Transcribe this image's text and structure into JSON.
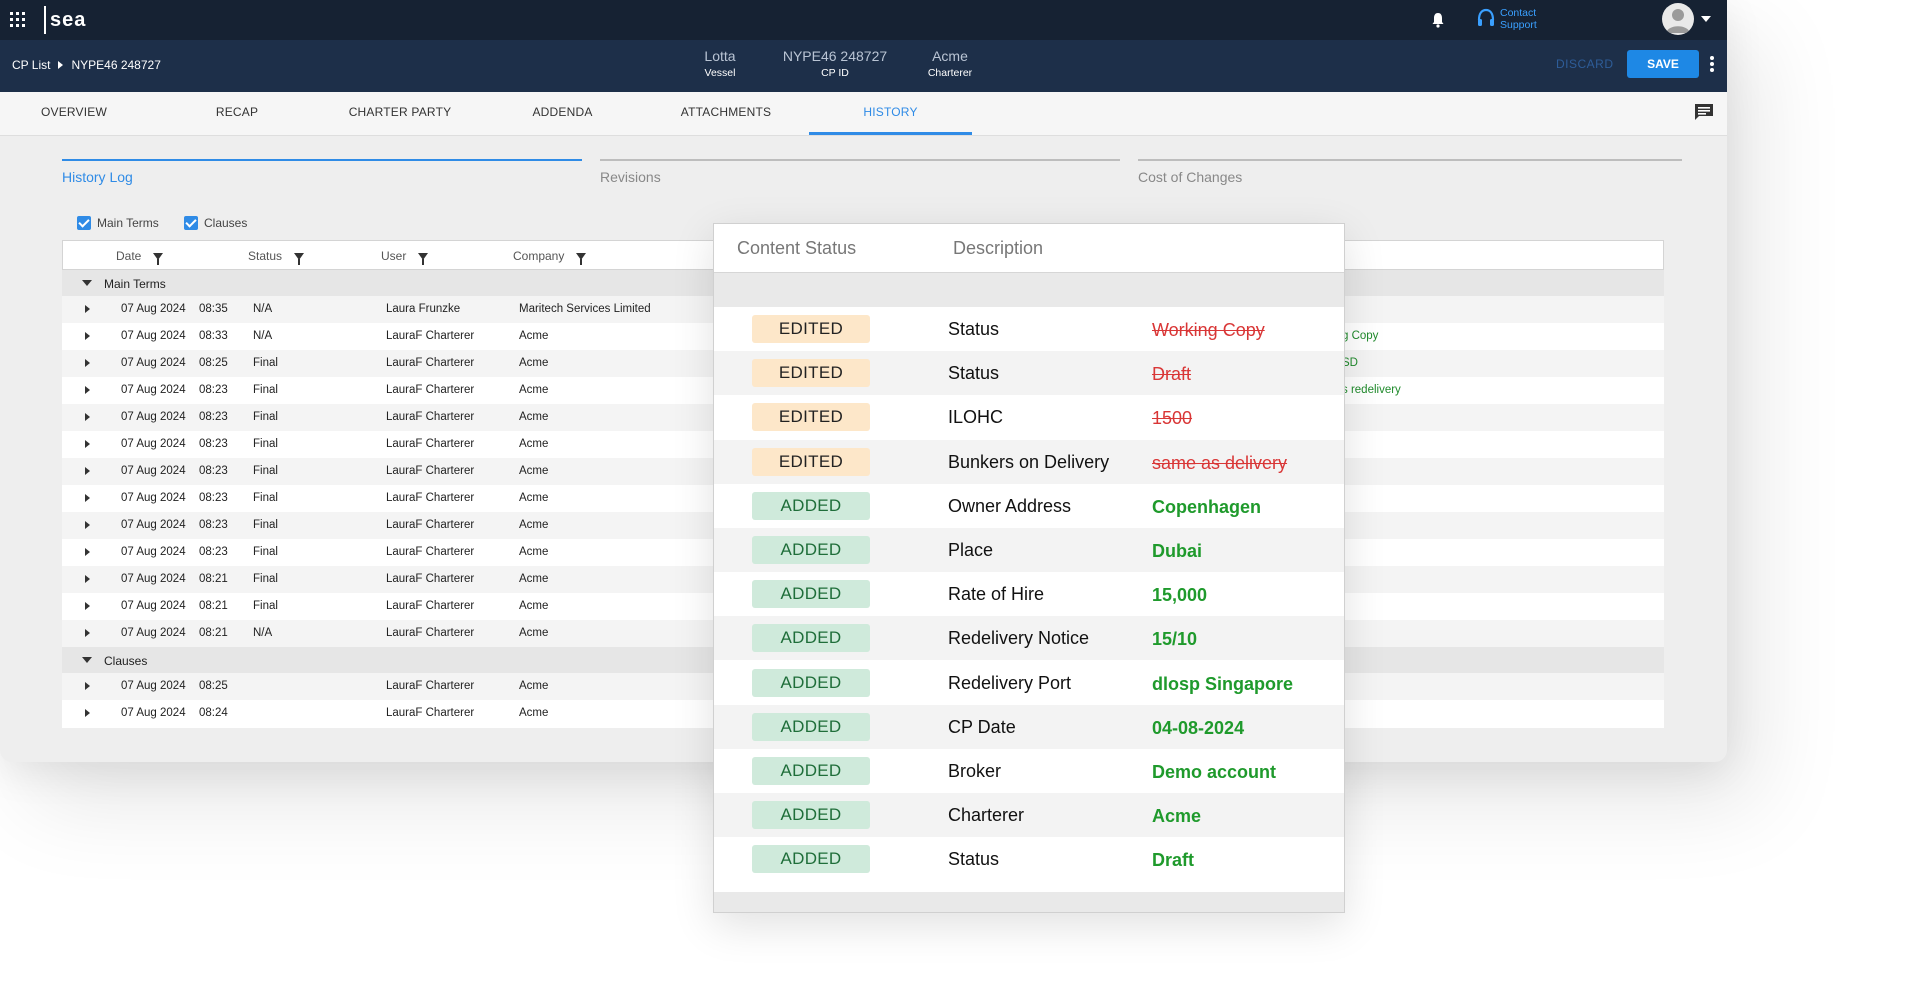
{
  "app": {
    "logo_text": "sea"
  },
  "topbar": {
    "support_line1": "Contact",
    "support_line2": "Support"
  },
  "subbar": {
    "breadcrumb": [
      "CP List",
      "NYPE46 248727"
    ],
    "meta": [
      {
        "value": "Lotta",
        "label": "Vessel"
      },
      {
        "value": "NYPE46 248727",
        "label": "CP ID"
      },
      {
        "value": "Acme",
        "label": "Charterer"
      }
    ],
    "discard_label": "DISCARD",
    "save_label": "SAVE"
  },
  "tabs": [
    "OVERVIEW",
    "RECAP",
    "CHARTER PARTY",
    "ADDENDA",
    "ATTACHMENTS",
    "HISTORY"
  ],
  "active_tab": "HISTORY",
  "subtabs": [
    "History Log",
    "Revisions",
    "Cost of Changes"
  ],
  "filters": [
    {
      "label": "Main Terms",
      "checked": true
    },
    {
      "label": "Clauses",
      "checked": true
    }
  ],
  "table": {
    "columns": [
      "Date",
      "Status",
      "User",
      "Company"
    ],
    "groups": [
      {
        "label": "Main Terms",
        "rows": [
          {
            "date": "07 Aug 2024",
            "time": "08:35",
            "status": "N/A",
            "user": "Laura Frunzke",
            "company": "Maritech Services Limited",
            "extra": ""
          },
          {
            "date": "07 Aug 2024",
            "time": "08:33",
            "status": "N/A",
            "user": "LauraF Charterer",
            "company": "Acme",
            "extra": "g Copy"
          },
          {
            "date": "07 Aug 2024",
            "time": "08:25",
            "status": "Final",
            "user": "LauraF Charterer",
            "company": "Acme",
            "extra": "SD"
          },
          {
            "date": "07 Aug 2024",
            "time": "08:23",
            "status": "Final",
            "user": "LauraF Charterer",
            "company": "Acme",
            "extra": "s redelivery"
          },
          {
            "date": "07 Aug 2024",
            "time": "08:23",
            "status": "Final",
            "user": "LauraF Charterer",
            "company": "Acme",
            "extra": ""
          },
          {
            "date": "07 Aug 2024",
            "time": "08:23",
            "status": "Final",
            "user": "LauraF Charterer",
            "company": "Acme",
            "extra": ""
          },
          {
            "date": "07 Aug 2024",
            "time": "08:23",
            "status": "Final",
            "user": "LauraF Charterer",
            "company": "Acme",
            "extra": ""
          },
          {
            "date": "07 Aug 2024",
            "time": "08:23",
            "status": "Final",
            "user": "LauraF Charterer",
            "company": "Acme",
            "extra": ""
          },
          {
            "date": "07 Aug 2024",
            "time": "08:23",
            "status": "Final",
            "user": "LauraF Charterer",
            "company": "Acme",
            "extra": ""
          },
          {
            "date": "07 Aug 2024",
            "time": "08:23",
            "status": "Final",
            "user": "LauraF Charterer",
            "company": "Acme",
            "extra": ""
          },
          {
            "date": "07 Aug 2024",
            "time": "08:21",
            "status": "Final",
            "user": "LauraF Charterer",
            "company": "Acme",
            "extra": ""
          },
          {
            "date": "07 Aug 2024",
            "time": "08:21",
            "status": "Final",
            "user": "LauraF Charterer",
            "company": "Acme",
            "extra": ""
          },
          {
            "date": "07 Aug 2024",
            "time": "08:21",
            "status": "N/A",
            "user": "LauraF Charterer",
            "company": "Acme",
            "extra": ""
          }
        ]
      },
      {
        "label": "Clauses",
        "rows": [
          {
            "date": "07 Aug 2024",
            "time": "08:25",
            "status": "",
            "user": "LauraF Charterer",
            "company": "Acme",
            "extra": ""
          },
          {
            "date": "07 Aug 2024",
            "time": "08:24",
            "status": "",
            "user": "LauraF Charterer",
            "company": "Acme",
            "extra": ""
          }
        ]
      }
    ]
  },
  "popup": {
    "headers": [
      "Content Status",
      "Description"
    ],
    "rows": [
      {
        "badge": "EDITED",
        "field": "Status",
        "value": "Working Copy"
      },
      {
        "badge": "EDITED",
        "field": "Status",
        "value": "Draft"
      },
      {
        "badge": "EDITED",
        "field": "ILOHC",
        "value": "1500"
      },
      {
        "badge": "EDITED",
        "field": "Bunkers on Delivery",
        "value": "same as delivery"
      },
      {
        "badge": "ADDED",
        "field": "Owner Address",
        "value": "Copenhagen"
      },
      {
        "badge": "ADDED",
        "field": "Place",
        "value": "Dubai"
      },
      {
        "badge": "ADDED",
        "field": "Rate of Hire",
        "value": "15,000"
      },
      {
        "badge": "ADDED",
        "field": "Redelivery Notice",
        "value": "15/10"
      },
      {
        "badge": "ADDED",
        "field": "Redelivery Port",
        "value": "dlosp Singapore"
      },
      {
        "badge": "ADDED",
        "field": "CP Date",
        "value": "04-08-2024"
      },
      {
        "badge": "ADDED",
        "field": "Broker",
        "value": "Demo account"
      },
      {
        "badge": "ADDED",
        "field": "Charterer",
        "value": "Acme"
      },
      {
        "badge": "ADDED",
        "field": "Status",
        "value": "Draft"
      }
    ]
  },
  "colors": {
    "topbar": "#162233",
    "subbar": "#1d2f49",
    "accent": "#2f8be6",
    "edited_badge": "#fde7c9",
    "added_badge": "#cfeadb",
    "old_value": "#d93636",
    "new_value": "#1f9a2c"
  }
}
